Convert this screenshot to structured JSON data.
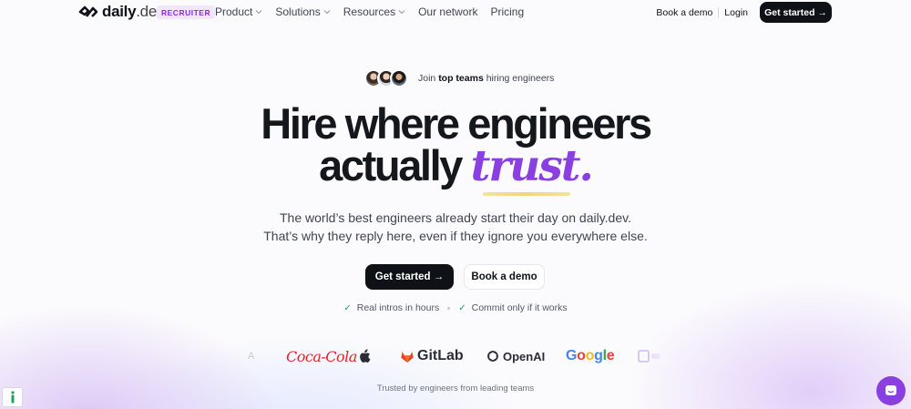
{
  "header": {
    "logo_word": "daily",
    "logo_suffix": ".dev",
    "badge": "RECRUITER",
    "nav": [
      {
        "label": "Product",
        "has_dropdown": true
      },
      {
        "label": "Solutions",
        "has_dropdown": true
      },
      {
        "label": "Resources",
        "has_dropdown": true
      },
      {
        "label": "Our network",
        "has_dropdown": false
      },
      {
        "label": "Pricing",
        "has_dropdown": false
      }
    ],
    "book_demo": "Book a demo",
    "login": "Login",
    "get_started": "Get started →"
  },
  "hero": {
    "social_proof_prefix": "Join ",
    "social_proof_bold": "top teams",
    "social_proof_suffix": " hiring engineers",
    "headline_line1": "Hire where engineers",
    "headline_line2_plain": "actually ",
    "headline_line2_accent": "trust.",
    "subtext_line1": "The world’s best engineers already start their day on daily.dev.",
    "subtext_line2": "That’s why they reply here, even if they ignore you everywhere else.",
    "cta_primary": "Get started  →",
    "cta_secondary": "Book a demo",
    "features": [
      "Real intros in hours",
      "Commit only if it works"
    ]
  },
  "logos": {
    "faded_left": "A",
    "cocacola": "Coca-Cola",
    "apple": "apple-logo",
    "gitlab": "GitLab",
    "openai": "OpenAI",
    "google": "Google",
    "trusted_caption": "Trusted by engineers from leading teams"
  },
  "colors": {
    "accent": "#8a3fe0",
    "badge_bg": "#f1e6fd",
    "primary_button": "#0e1217",
    "check": "#1ca35e"
  }
}
